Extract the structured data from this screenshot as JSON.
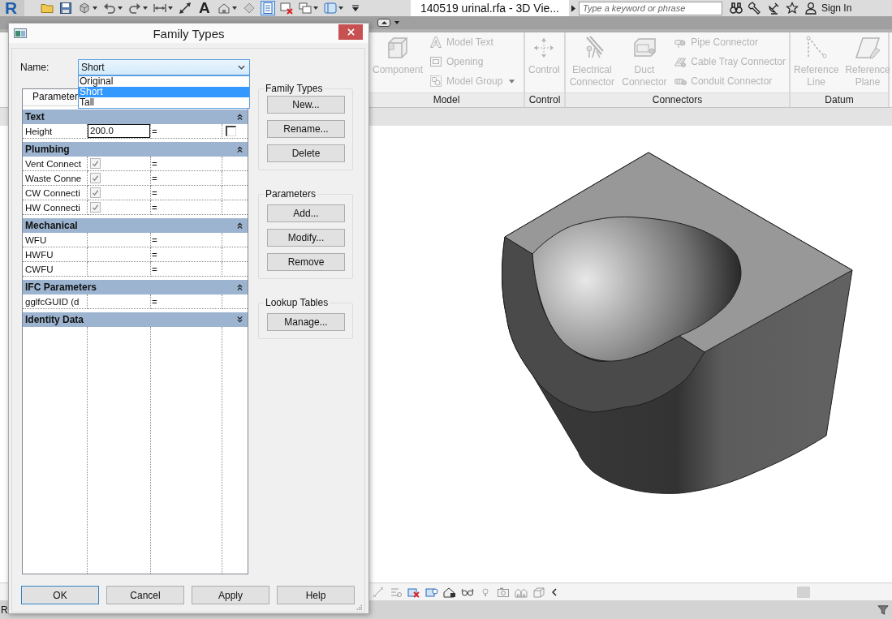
{
  "app": {
    "logo": "R",
    "text_tool": "A",
    "thin_lines_on": true,
    "document_title": "140519 urinal.rfa - 3D Vie...",
    "search": {
      "placeholder": "Type a keyword or phrase"
    },
    "sign_in": "Sign In"
  },
  "ribbon": {
    "panels": [
      {
        "title": "Model",
        "items": [
          {
            "kind": "large",
            "label": "Component",
            "disabled": true
          },
          {
            "kind": "small",
            "label": "Model Text",
            "disabled": true
          },
          {
            "kind": "small",
            "label": "Opening",
            "disabled": true
          },
          {
            "kind": "small",
            "label": "Model Group",
            "disabled": true,
            "dropdown": true
          }
        ]
      },
      {
        "title": "Control",
        "items": [
          {
            "kind": "large",
            "label": "Control",
            "disabled": true
          }
        ]
      },
      {
        "title": "Connectors",
        "items": [
          {
            "kind": "large",
            "label": "Electrical Connector",
            "disabled": true
          },
          {
            "kind": "large",
            "label": "Duct Connector",
            "disabled": true
          },
          {
            "kind": "small",
            "label": "Pipe Connector",
            "disabled": true
          },
          {
            "kind": "small",
            "label": "Cable Tray Connector",
            "disabled": true
          },
          {
            "kind": "small",
            "label": "Conduit Connector",
            "disabled": true
          }
        ]
      },
      {
        "title": "Datum",
        "items": [
          {
            "kind": "large",
            "label": "Reference Line",
            "disabled": true
          },
          {
            "kind": "large",
            "label": "Reference Plane",
            "disabled": true
          }
        ]
      }
    ]
  },
  "dialog": {
    "title": "Family Types",
    "name_field": {
      "label": "Name:",
      "value": "Short",
      "open": true,
      "options": [
        {
          "label": "Original",
          "selected": false
        },
        {
          "label": "Short",
          "selected": true
        },
        {
          "label": "Tall",
          "selected": false
        }
      ]
    },
    "table": {
      "header": "Parameter",
      "groups": [
        {
          "title": "Text",
          "expanded": true,
          "rows": [
            {
              "kind": "number",
              "name": "Height",
              "value": "200.0",
              "formula": "=",
              "locked": false
            }
          ]
        },
        {
          "title": "Plumbing",
          "expanded": true,
          "rows": [
            {
              "kind": "yesno",
              "name": "Vent Connect",
              "checked": true,
              "disabled": true,
              "formula": "="
            },
            {
              "kind": "yesno",
              "name": "Waste Conne",
              "checked": true,
              "disabled": true,
              "formula": "="
            },
            {
              "kind": "yesno",
              "name": "CW Connecti",
              "checked": true,
              "disabled": true,
              "formula": "="
            },
            {
              "kind": "yesno",
              "name": "HW Connecti",
              "checked": true,
              "disabled": true,
              "formula": "="
            }
          ]
        },
        {
          "title": "Mechanical",
          "expanded": true,
          "rows": [
            {
              "kind": "text",
              "name": "WFU",
              "formula": "="
            },
            {
              "kind": "text",
              "name": "HWFU",
              "formula": "="
            },
            {
              "kind": "text",
              "name": "CWFU",
              "formula": "="
            }
          ]
        },
        {
          "title": "IFC Parameters",
          "expanded": true,
          "rows": [
            {
              "kind": "text",
              "name": "gglfcGUID (d",
              "formula": "="
            }
          ]
        },
        {
          "title": "Identity Data",
          "expanded": false
        }
      ]
    },
    "groups": [
      {
        "title": "Family Types",
        "buttons": [
          "New...",
          "Rename...",
          "Delete"
        ]
      },
      {
        "title": "Parameters",
        "buttons": [
          "Add...",
          "Modify...",
          "Remove"
        ]
      },
      {
        "title": "Lookup Tables",
        "buttons": [
          "Manage..."
        ]
      }
    ],
    "buttons": [
      {
        "label": "OK",
        "default": true
      },
      {
        "label": "Cancel",
        "default": false
      },
      {
        "label": "Apply",
        "default": false
      },
      {
        "label": "Help",
        "default": false
      }
    ]
  },
  "status_bar": {
    "text": "R"
  }
}
